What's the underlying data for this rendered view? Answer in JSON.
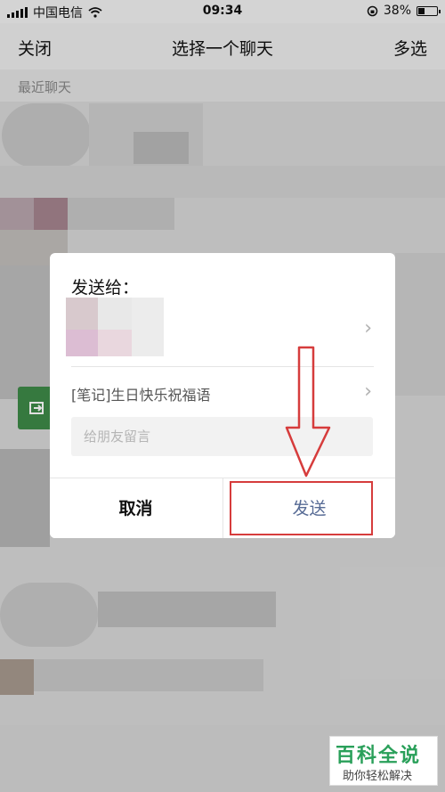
{
  "status_bar": {
    "carrier": "中国电信",
    "time": "09:34",
    "battery": "38%",
    "battery_level": 0.38
  },
  "nav": {
    "close": "关闭",
    "title": "选择一个聊天",
    "multi_select": "多选"
  },
  "section": {
    "recent_label": "最近聊天"
  },
  "dialog": {
    "heading": "发送给：",
    "shared_item": "[笔记]生日快乐祝福语",
    "message_placeholder": "给朋友留言",
    "cancel_label": "取消",
    "send_label": "发送"
  },
  "watermark": {
    "title": "百科全说",
    "subtitle": "助你轻松解决"
  },
  "colors": {
    "send_text": "#576b95",
    "highlight": "#d63c3c",
    "watermark_green": "#2aa05a"
  }
}
